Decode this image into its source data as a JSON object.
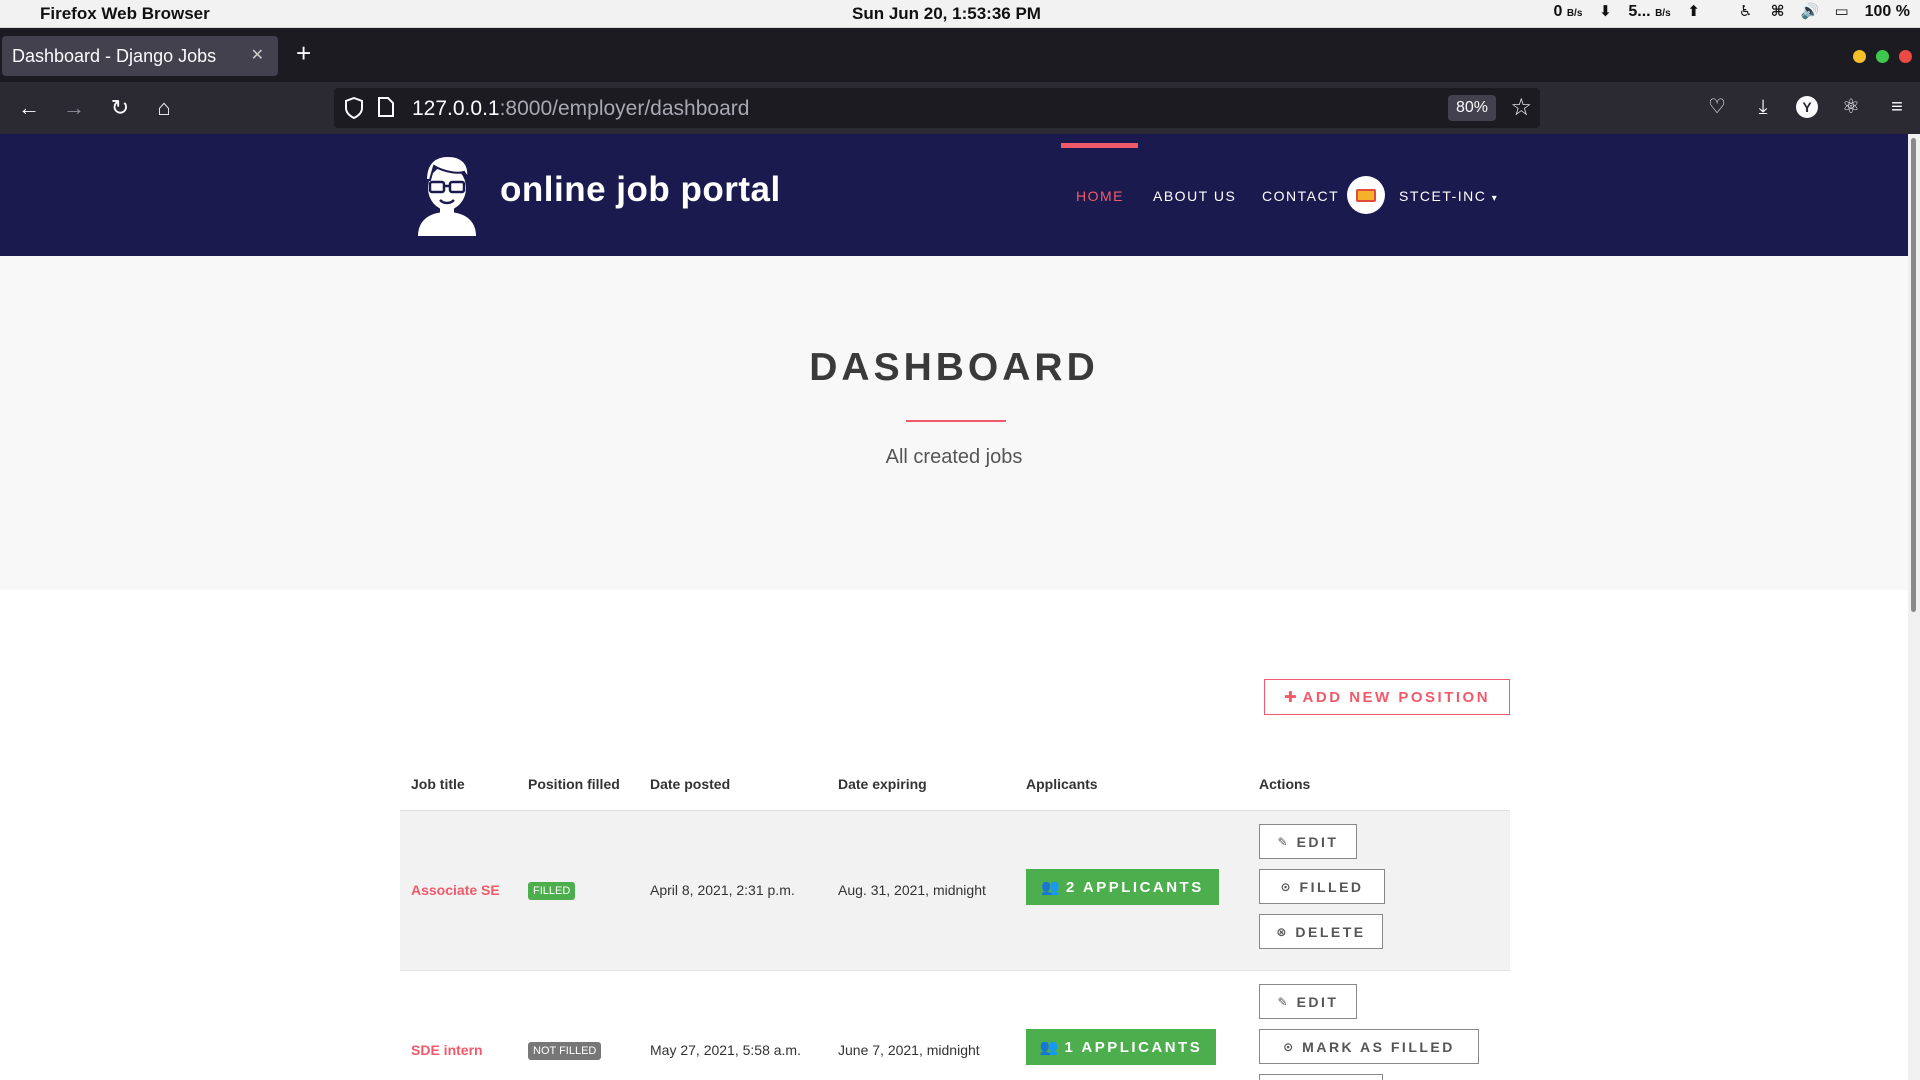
{
  "os": {
    "app_name": "Firefox Web Browser",
    "clock": "Sun Jun 20,  1:53:36 PM",
    "net_down": "0",
    "net_down_unit": "B/s",
    "net_up": "5...",
    "net_up_unit": "B/s",
    "battery": "100 %"
  },
  "browser": {
    "tab_title": "Dashboard - Django Jobs",
    "url_host": "127.0.0.1",
    "url_rest": ":8000/employer/dashboard",
    "zoom": "80%"
  },
  "site": {
    "title": "online job portal",
    "nav": {
      "home": "HOME",
      "about": "ABOUT US",
      "contact": "CONTACT",
      "user": "STCET-INC"
    }
  },
  "hero": {
    "title": "DASHBOARD",
    "subtitle": "All created jobs"
  },
  "add_button": "ADD NEW POSITION",
  "table": {
    "headers": {
      "title": "Job title",
      "filled": "Position filled",
      "posted": "Date posted",
      "expiring": "Date expiring",
      "applicants": "Applicants",
      "actions": "Actions"
    },
    "rows": [
      {
        "title": "Associate SE",
        "status": "FILLED",
        "posted": "April 8, 2021, 2:31 p.m.",
        "expiring": "Aug. 31, 2021, midnight",
        "applicants": "2 APPLICANTS",
        "actions": [
          "EDIT",
          "FILLED",
          "DELETE"
        ]
      },
      {
        "title": "SDE intern",
        "status": "NOT FILLED",
        "posted": "May 27, 2021, 5:58 a.m.",
        "expiring": "June 7, 2021, midnight",
        "applicants": "1 APPLICANTS",
        "actions": [
          "EDIT",
          "MARK AS FILLED"
        ]
      }
    ]
  },
  "colors": {
    "header_bg": "#1b1a4f",
    "accent": "#f05a6a",
    "success": "#4cae4c"
  }
}
